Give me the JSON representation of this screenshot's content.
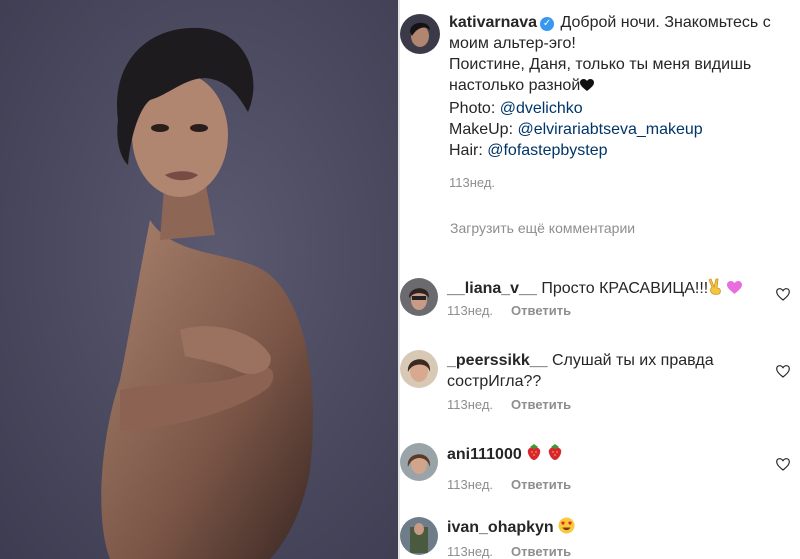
{
  "post": {
    "author": "kativarnava",
    "caption_lines": [
      "Доброй ночи. Знакомьтесь с",
      "моим альтер-эго!",
      "Поистине, Даня, только ты меня видишь",
      "настолько разной"
    ],
    "credits": [
      {
        "label": "Photo: ",
        "handle": "@dvelichko"
      },
      {
        "label": "MakeUp: ",
        "handle": "@elvirariabtseva_makeup"
      },
      {
        "label": "Hair: ",
        "handle": "@fofastepbystep"
      }
    ],
    "time": "113нед."
  },
  "load_more": "Загрузить ещё комментарии",
  "comments": [
    {
      "user": "__liana_v__",
      "text": "Просто КРАСАВИЦА!!!",
      "time": "113нед.",
      "reply": "Ответить"
    },
    {
      "user": "_peerssikk__",
      "text": "Слушай ты их правда",
      "text2": "сострИгла??",
      "time": "113нед.",
      "reply": "Ответить"
    },
    {
      "user": "ani111000",
      "text": "",
      "time": "113нед.",
      "reply": "Ответить"
    },
    {
      "user": "ivan_ohapkyn",
      "text": "",
      "time": "113нед.",
      "reply": "Ответить"
    }
  ],
  "colors": {
    "verified": "#3897f0",
    "link": "#003569",
    "muted": "#8e8e8e",
    "photo_bg": "#4b4a61"
  },
  "icons": [
    "verified-badge-icon",
    "black-heart-emoji",
    "victory-hand-emoji",
    "purple-heart-emoji",
    "strawberry-emoji",
    "heart-eyes-emoji",
    "like-heart-icon"
  ]
}
